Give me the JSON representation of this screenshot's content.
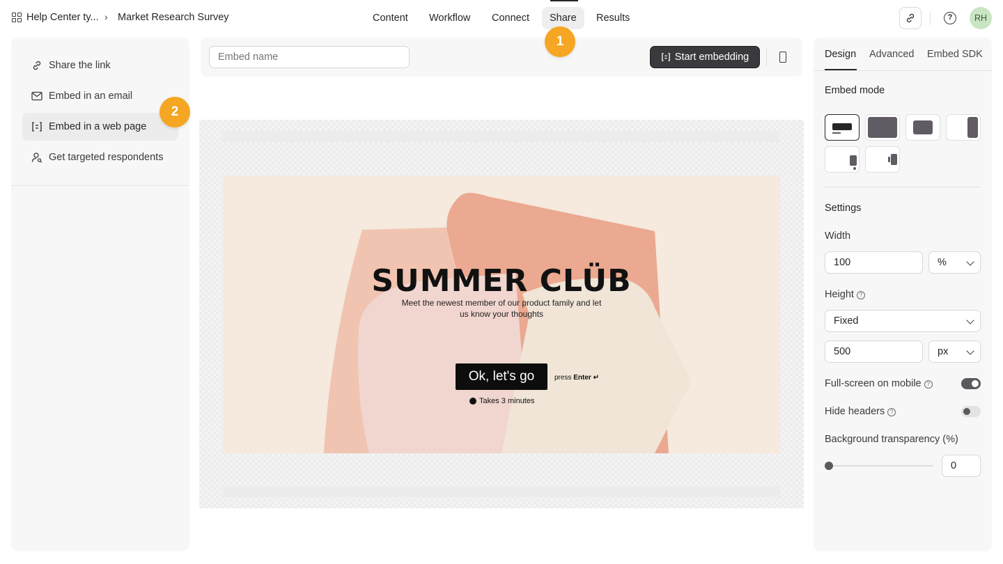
{
  "breadcrumb": {
    "workspace": "Help Center ty...",
    "separator": "›",
    "form": "Market Research Survey"
  },
  "nav": {
    "tabs": [
      "Content",
      "Workflow",
      "Connect",
      "Share",
      "Results"
    ],
    "active": "Share"
  },
  "user": {
    "initials": "RH",
    "avatar_color": "#c9e5c2"
  },
  "badges": [
    "1",
    "2"
  ],
  "sidebar": {
    "items": [
      {
        "label": "Share the link",
        "icon": "link-icon"
      },
      {
        "label": "Embed in an email",
        "icon": "mail-icon"
      },
      {
        "label": "Embed in a web page",
        "icon": "embed-code-icon"
      },
      {
        "label": "Get targeted respondents",
        "icon": "person-search-icon"
      }
    ],
    "active_index": 2
  },
  "toolbar": {
    "embed_name_placeholder": "Embed name",
    "start_label": "Start embedding"
  },
  "survey": {
    "title": "SUMMER CLÜB",
    "subtitle": "Meet the newest member of our product family and let us know your thoughts",
    "button": "Ok, let's go",
    "press": "press",
    "press_key": "Enter ↵",
    "duration": "Takes 3 minutes"
  },
  "panel": {
    "tabs": [
      "Design",
      "Advanced",
      "Embed SDK"
    ],
    "embed_mode_label": "Embed mode",
    "settings_label": "Settings",
    "width_label": "Width",
    "width_value": "100",
    "width_unit": "%",
    "height_label": "Height",
    "height_mode": "Fixed",
    "height_value": "500",
    "height_unit": "px",
    "fullscreen_label": "Full-screen on mobile",
    "fullscreen_on": true,
    "hide_headers_label": "Hide headers",
    "hide_headers_on": false,
    "bg_label": "Background transparency (%)",
    "bg_value": "0"
  },
  "colors": {
    "accent_badge": "#f5a623",
    "primary_button": "#3a3a3e"
  }
}
